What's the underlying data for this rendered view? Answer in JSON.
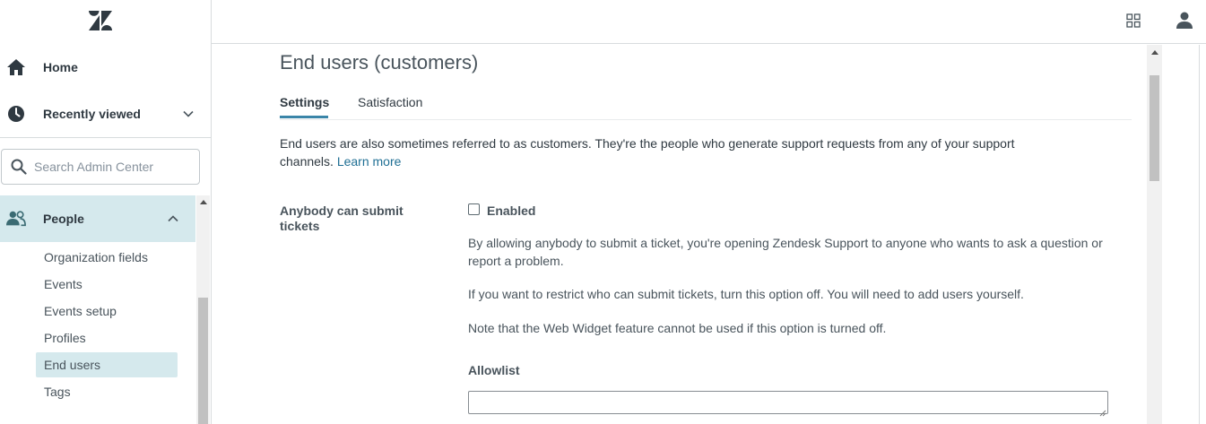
{
  "sidebar": {
    "home_label": "Home",
    "recent_label": "Recently viewed",
    "search_placeholder": "Search Admin Center",
    "people_label": "People",
    "people_items": [
      "Organization fields",
      "Events",
      "Events setup",
      "Profiles",
      "End users",
      "Tags"
    ],
    "active_item": "End users"
  },
  "main": {
    "title": "End users (customers)",
    "tabs": [
      {
        "label": "Settings",
        "active": true
      },
      {
        "label": "Satisfaction",
        "active": false
      }
    ],
    "intro_text": "End users are also sometimes referred to as customers. They're the people who generate support requests from any of your support channels.",
    "intro_link": "Learn more",
    "field_label": "Anybody can submit tickets",
    "checkbox_label": "Enabled",
    "checkbox_checked": false,
    "para1": "By allowing anybody to submit a ticket, you're opening Zendesk Support to anyone who wants to ask a question or report a problem.",
    "para2": "If you want to restrict who can submit tickets, turn this option off. You will need to add users yourself.",
    "para3": "Note that the Web Widget feature cannot be used if this option is turned off.",
    "allowlist_label": "Allowlist",
    "allowlist_value": ""
  },
  "colors": {
    "accent_bg": "#d5e9ed",
    "nav_icon": "#3b6b73",
    "link": "#1f6f94"
  }
}
